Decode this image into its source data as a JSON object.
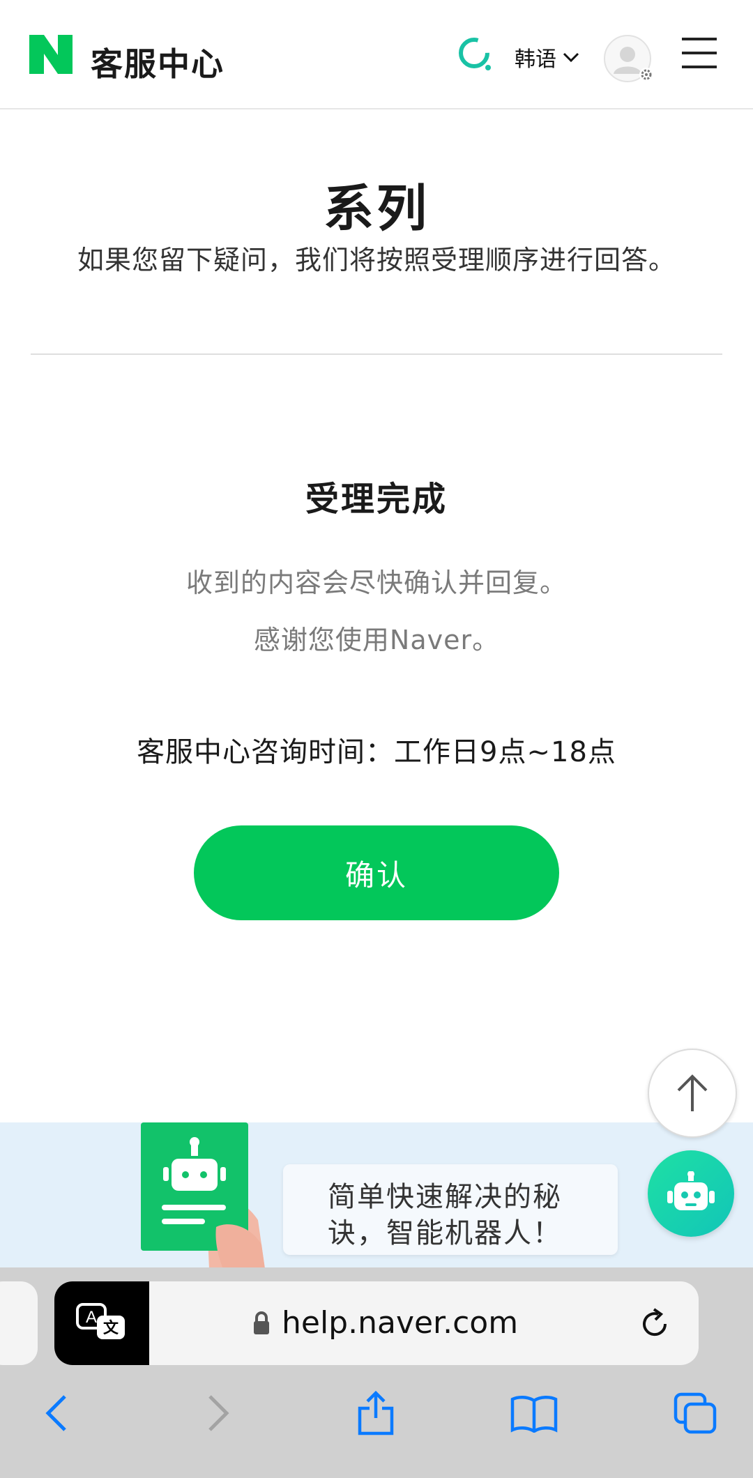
{
  "header": {
    "logo_letter": "N",
    "title": "客服中心",
    "language": "韩语",
    "icons": {
      "search": "search-icon",
      "chevron": "chevron-down-icon",
      "avatar": "user-avatar-icon",
      "settings": "gear-icon",
      "menu": "hamburger-menu-icon"
    }
  },
  "main": {
    "title": "系列",
    "subtitle": "如果您留下疑问，我们将按照受理顺序进行回答。",
    "done_title": "受理完成",
    "message_line1": "收到的内容会尽快确认并回复。",
    "message_line2": "感谢您使用Naver。",
    "hours": "客服中心咨询时间：工作日9点~18点",
    "confirm_label": "确认"
  },
  "floating": {
    "scroll_top_icon": "arrow-up-icon",
    "chatbot_icon": "robot-icon"
  },
  "banner": {
    "line1": "简单快速解决的秘",
    "line2": "诀，智能机器人！"
  },
  "browser": {
    "url": "help.naver.com",
    "icons": [
      "translate-icon",
      "lock-icon",
      "reload-icon",
      "back-icon",
      "forward-icon",
      "share-icon",
      "bookmarks-icon",
      "tabs-icon"
    ]
  },
  "colors": {
    "brand_green": "#03c75a",
    "search_teal": "#19c2a5",
    "banner_bg": "#e3f0fa",
    "ios_blue": "#0a7aff"
  }
}
